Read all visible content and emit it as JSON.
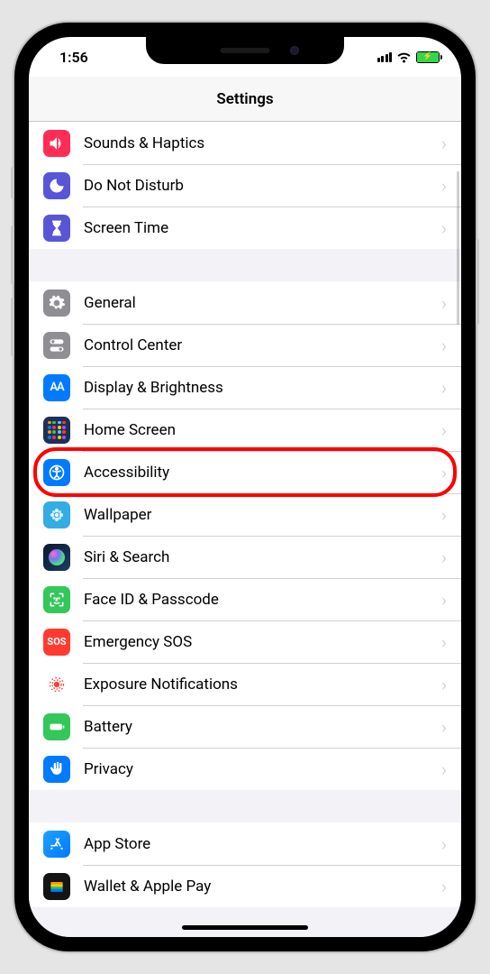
{
  "status": {
    "time": "1:56"
  },
  "header": {
    "title": "Settings"
  },
  "groups": [
    {
      "items": [
        {
          "id": "sounds-haptics",
          "label": "Sounds & Haptics",
          "icon": "speaker-icon",
          "color": "c-pink"
        },
        {
          "id": "do-not-disturb",
          "label": "Do Not Disturb",
          "icon": "moon-icon",
          "color": "c-purple"
        },
        {
          "id": "screen-time",
          "label": "Screen Time",
          "icon": "hourglass-icon",
          "color": "c-purple"
        }
      ]
    },
    {
      "items": [
        {
          "id": "general",
          "label": "General",
          "icon": "gear-icon",
          "color": "c-gray"
        },
        {
          "id": "control-center",
          "label": "Control Center",
          "icon": "switch-icon",
          "color": "c-gray"
        },
        {
          "id": "display-brightness",
          "label": "Display & Brightness",
          "icon": "textsize-icon",
          "color": "c-blue"
        },
        {
          "id": "home-screen",
          "label": "Home Screen",
          "icon": "apps-icon",
          "color": "c-darkblue"
        },
        {
          "id": "accessibility",
          "label": "Accessibility",
          "icon": "accessibility-icon",
          "color": "c-blue",
          "highlight": true
        },
        {
          "id": "wallpaper",
          "label": "Wallpaper",
          "icon": "flower-icon",
          "color": "c-cyan"
        },
        {
          "id": "siri-search",
          "label": "Siri & Search",
          "icon": "siri-icon",
          "color": "siri-bg"
        },
        {
          "id": "face-id",
          "label": "Face ID & Passcode",
          "icon": "faceid-icon",
          "color": "c-green"
        },
        {
          "id": "emergency-sos",
          "label": "Emergency SOS",
          "icon": "sos-icon",
          "color": "c-red"
        },
        {
          "id": "exposure-notifications",
          "label": "Exposure Notifications",
          "icon": "exposure-icon",
          "color": "c-white"
        },
        {
          "id": "battery",
          "label": "Battery",
          "icon": "battery-icon",
          "color": "c-green"
        },
        {
          "id": "privacy",
          "label": "Privacy",
          "icon": "hand-icon",
          "color": "c-blue"
        }
      ]
    },
    {
      "items": [
        {
          "id": "app-store",
          "label": "App Store",
          "icon": "appstore-icon",
          "color": "c-bluegrad"
        },
        {
          "id": "wallet",
          "label": "Wallet & Apple Pay",
          "icon": "wallet-icon",
          "color": "c-black"
        }
      ]
    }
  ]
}
